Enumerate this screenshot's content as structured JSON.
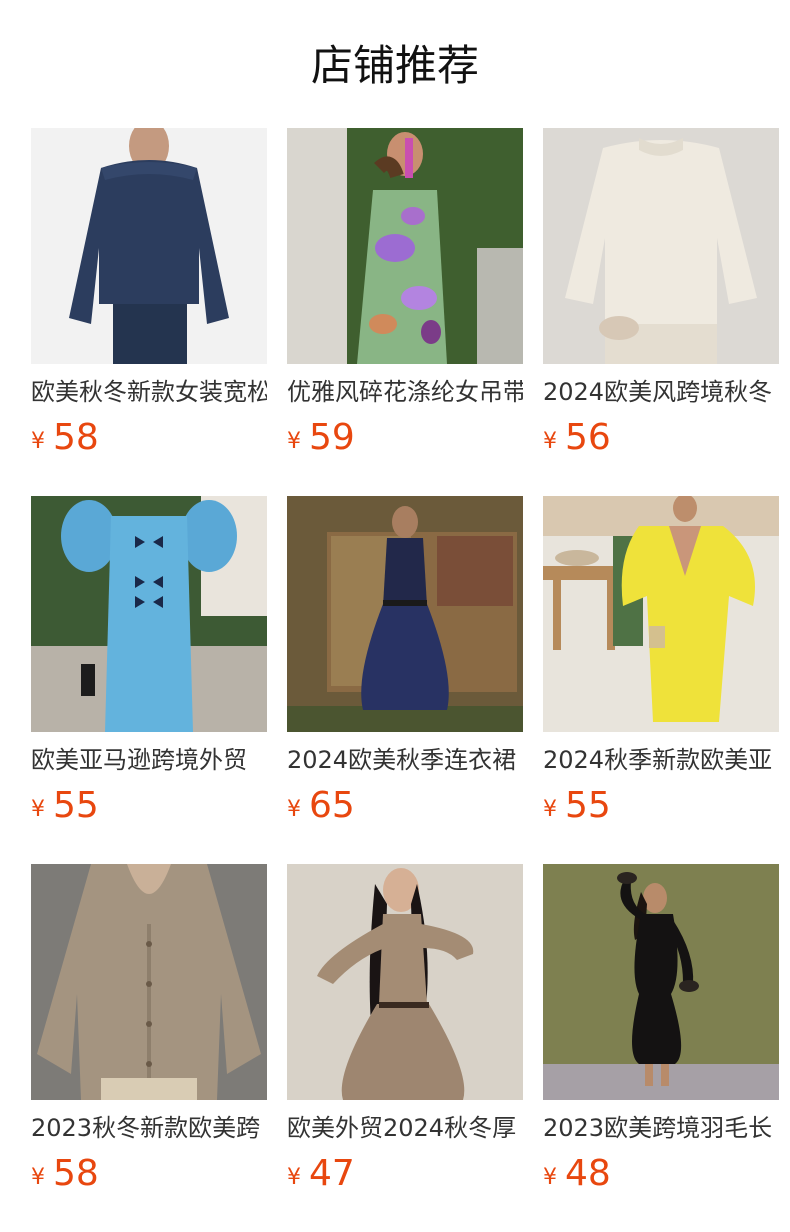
{
  "section": {
    "title": "店铺推荐"
  },
  "products": [
    {
      "name": "欧美秋冬新款女装宽松",
      "currency": "¥",
      "price": "58"
    },
    {
      "name": "优雅风碎花涤纶女吊带",
      "currency": "¥",
      "price": "59"
    },
    {
      "name": "2024欧美风跨境秋冬",
      "currency": "¥",
      "price": "56"
    },
    {
      "name": "欧美亚马逊跨境外贸",
      "currency": "¥",
      "price": "55"
    },
    {
      "name": "2024欧美秋季连衣裙",
      "currency": "¥",
      "price": "65"
    },
    {
      "name": "2024秋季新款欧美亚",
      "currency": "¥",
      "price": "55"
    },
    {
      "name": "2023秋冬新款欧美跨",
      "currency": "¥",
      "price": "58"
    },
    {
      "name": "欧美外贸2024秋冬厚",
      "currency": "¥",
      "price": "47"
    },
    {
      "name": "2023欧美跨境羽毛长",
      "currency": "¥",
      "price": "48"
    }
  ],
  "colors": {
    "price": "#e8470f",
    "text": "#333333"
  }
}
